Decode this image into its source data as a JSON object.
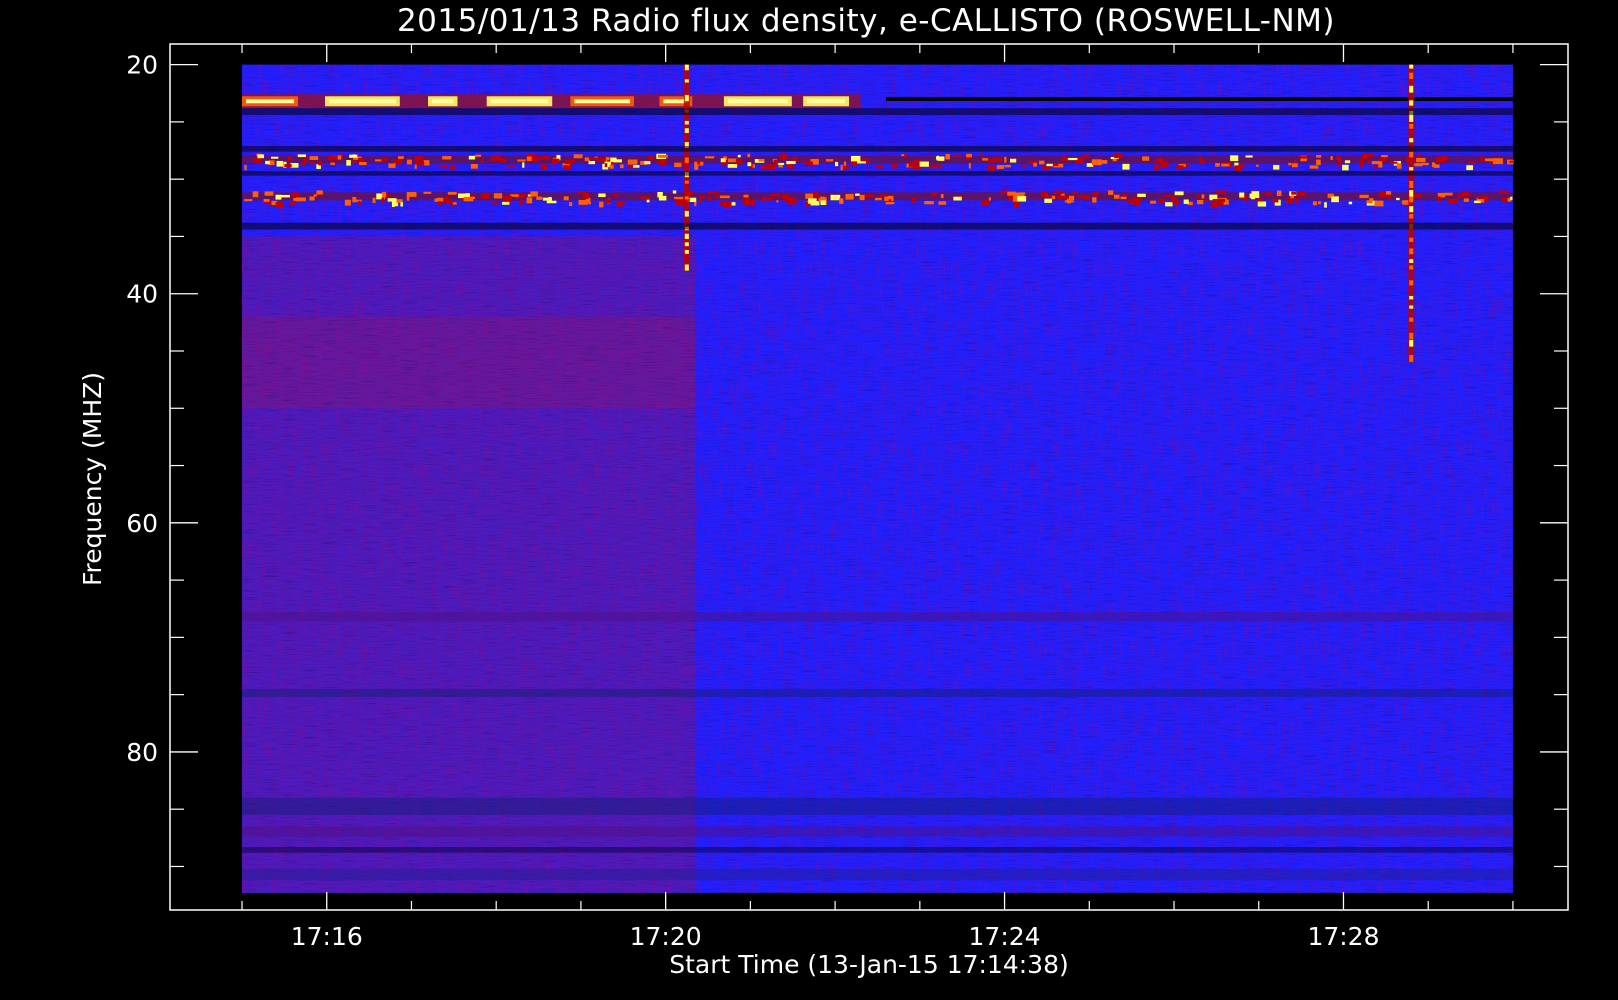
{
  "chart_data": {
    "type": "heatmap",
    "title": "2015/01/13  Radio flux density, e-CALLISTO (ROSWELL-NM)",
    "xlabel": "Start Time (13-Jan-15 17:14:38)",
    "ylabel": "Frequency (MHZ)",
    "x_ticks": [
      {
        "label": "17:16",
        "value": 16
      },
      {
        "label": "17:20",
        "value": 20
      },
      {
        "label": "17:24",
        "value": 24
      },
      {
        "label": "17:28",
        "value": 28
      }
    ],
    "x_minor_ticks": [
      15,
      17,
      18,
      19,
      21,
      22,
      23,
      25,
      26,
      27,
      29,
      30
    ],
    "x_range": [
      14.15,
      30.65
    ],
    "x_data_range": [
      15.0,
      30.0
    ],
    "y_ticks": [
      {
        "label": "20",
        "value": 20
      },
      {
        "label": "40",
        "value": 40
      },
      {
        "label": "60",
        "value": 60
      },
      {
        "label": "80",
        "value": 80
      }
    ],
    "y_minor_ticks": [
      25,
      30,
      35,
      45,
      50,
      55,
      65,
      70,
      75,
      85,
      90
    ],
    "y_range": [
      18.2,
      93.8
    ],
    "y_data_range": [
      20,
      92.3
    ],
    "y_inverted": true,
    "colormap": [
      "#000000",
      "#2020ff",
      "#c00000",
      "#ff6000",
      "#ffff60"
    ],
    "features": [
      {
        "kind": "band",
        "freq": 23.2,
        "intensity": "high",
        "from": 15.0,
        "to": 22.3,
        "pattern": "intermittent"
      },
      {
        "kind": "dark-line",
        "freq": 23.0,
        "from": 22.6,
        "to": 30.0
      },
      {
        "kind": "band",
        "freq": 28.3,
        "intensity": "medium",
        "from": 15.0,
        "to": 30.0,
        "pattern": "speckled"
      },
      {
        "kind": "band",
        "freq": 31.5,
        "intensity": "medium",
        "from": 15.0,
        "to": 30.0,
        "pattern": "speckled"
      },
      {
        "kind": "vertical-burst",
        "time": 28.8,
        "freq_from": 20,
        "freq_to": 46
      },
      {
        "kind": "vertical-burst",
        "time": 20.25,
        "freq_from": 20,
        "freq_to": 38
      },
      {
        "kind": "background-shift",
        "time": 20.35,
        "left": "purple",
        "right": "blue"
      }
    ]
  }
}
